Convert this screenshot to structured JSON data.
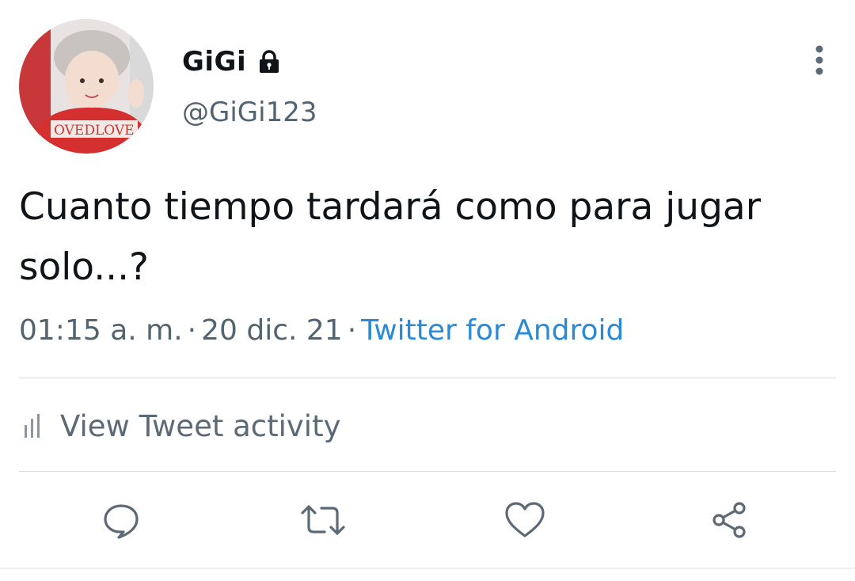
{
  "author": {
    "display_name": "GiGi",
    "handle": "@GiGi123",
    "protected": true,
    "avatar_icon": "profile-photo"
  },
  "tweet": {
    "text": "Cuanto tiempo tardará como para jugar solo...?",
    "time": "01:15 a. m.",
    "date": "20 dic. 21",
    "separator": "·",
    "source": "Twitter for Android"
  },
  "activity": {
    "label": "View Tweet activity",
    "icon": "bar-chart-icon"
  },
  "actions": {
    "reply_icon": "reply-icon",
    "retweet_icon": "retweet-icon",
    "like_icon": "heart-icon",
    "share_icon": "share-icon"
  },
  "colors": {
    "text": "#0f1419",
    "secondary": "#536471",
    "link": "#2a8ad8",
    "divider": "#d7dde2"
  }
}
